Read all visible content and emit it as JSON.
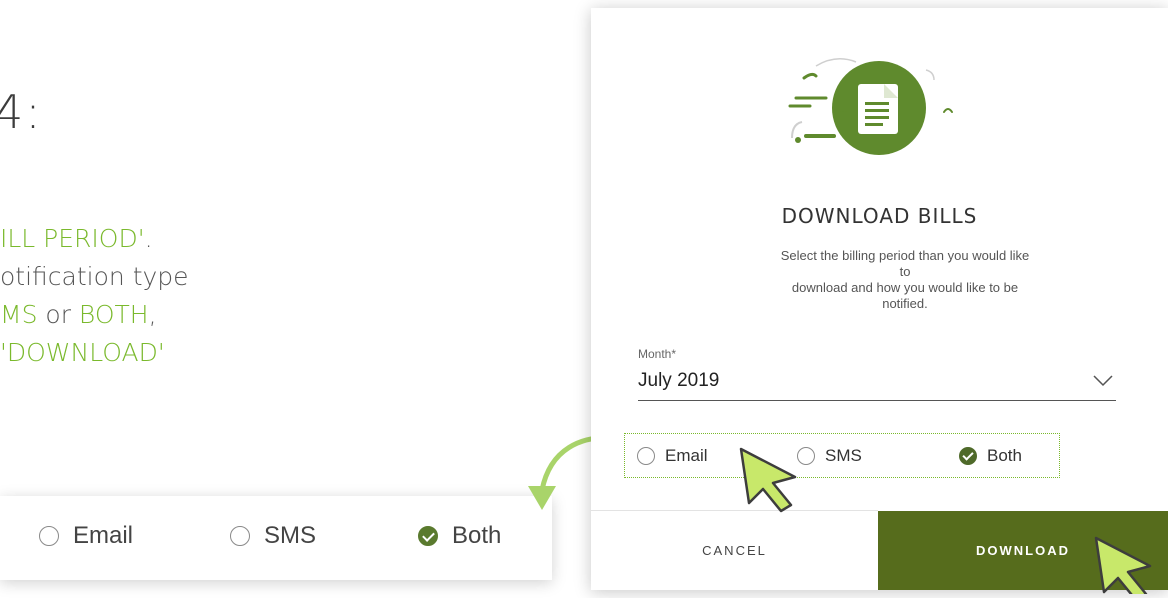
{
  "left_panel": {
    "step_heading": "4:",
    "line1_hl": "ILL PERIOD'",
    "line1_tail": ".",
    "line2": "otification type",
    "line3_hl1": "MS",
    "line3_mid": " or ",
    "line3_hl2": "BOTH",
    "line3_tail": ",",
    "line4_hl": " 'DOWNLOAD'"
  },
  "zoom_strip": {
    "options": [
      {
        "label": "Email",
        "checked": false
      },
      {
        "label": "SMS",
        "checked": false
      },
      {
        "label": "Both",
        "checked": true
      }
    ]
  },
  "dialog": {
    "title": "DOWNLOAD BILLS",
    "description_line1": "Select the billing period than you would like",
    "description_line2": "to",
    "description_line3": "download and how you would like to be",
    "description_line4": "notified.",
    "month_label": "Month*",
    "month_value": "July 2019",
    "options": [
      {
        "label": "Email",
        "checked": false
      },
      {
        "label": "SMS",
        "checked": false
      },
      {
        "label": "Both",
        "checked": true
      }
    ],
    "cancel_label": "CANCEL",
    "download_label": "DOWNLOAD"
  },
  "colors": {
    "accent_green": "#7ab92c",
    "dark_green": "#566c1c",
    "icon_green": "#5f8a2d"
  }
}
